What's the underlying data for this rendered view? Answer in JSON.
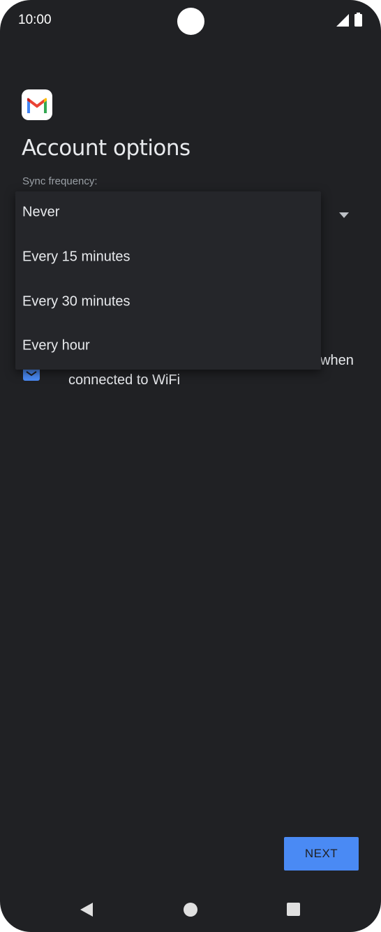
{
  "status_bar": {
    "time": "10:00",
    "icons": [
      "camera-cutout",
      "signal-icon",
      "battery-icon"
    ]
  },
  "app": {
    "logo_icon": "gmail-logo-icon"
  },
  "page": {
    "title": "Account options",
    "sync_label": "Sync frequency:"
  },
  "dropdown": {
    "selected": "Never",
    "options": [
      "Never",
      "Every 15 minutes",
      "Every 30 minutes",
      "Every hour"
    ],
    "arrow_icon": "dropdown-arrow-icon"
  },
  "wifi_option": {
    "checked": true,
    "label_line1_visible": "when",
    "label_line2": "connected to WiFi"
  },
  "footer": {
    "next_label": "NEXT"
  },
  "nav_bar": {
    "icons": [
      "back-icon",
      "home-icon",
      "recents-icon"
    ]
  },
  "colors": {
    "background": "#202124",
    "menu_background": "#25262a",
    "accent": "#4a8af4",
    "text_primary": "#e8eaed",
    "text_secondary": "#9aa0a6"
  }
}
